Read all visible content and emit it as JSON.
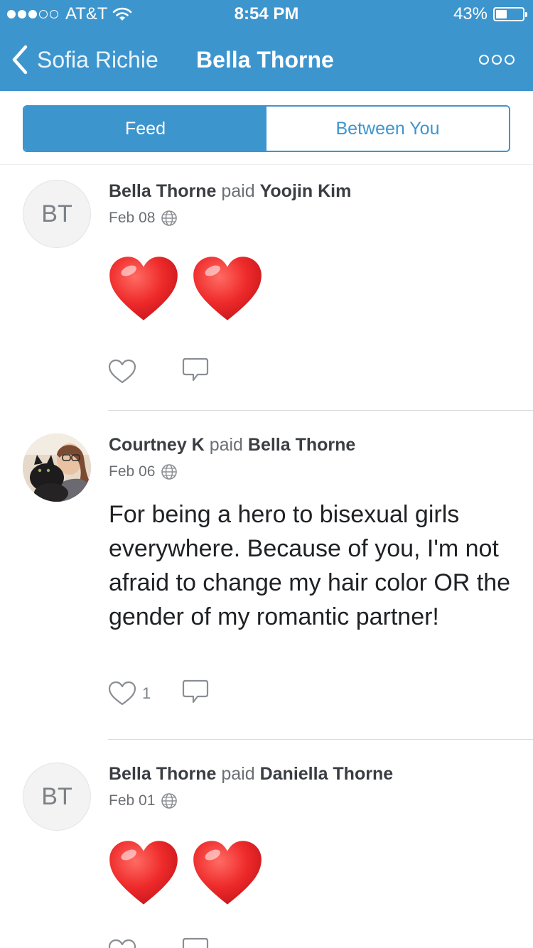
{
  "status_bar": {
    "carrier": "AT&T",
    "signal_filled": 3,
    "signal_total": 5,
    "time": "8:54 PM",
    "battery": "43%",
    "battery_level": 0.43
  },
  "nav": {
    "back_label": "Sofia Richie",
    "title": "Bella Thorne"
  },
  "tabs": [
    {
      "label": "Feed",
      "active": true
    },
    {
      "label": "Between You",
      "active": false
    }
  ],
  "feed": [
    {
      "avatar_initials": "BT",
      "actor": "Bella Thorne",
      "verb": "paid",
      "target": "Yoojin Kim",
      "date": "Feb 08",
      "message_emoji": "❤❤",
      "likes": ""
    },
    {
      "avatar_initials": "",
      "actor": "Courtney K",
      "verb": "paid",
      "target": "Bella Thorne",
      "date": "Feb 06",
      "message": "For being a hero to bisexual girls everywhere. Because of you, I'm not afraid to change my hair color OR the gender of my romantic partner!",
      "likes": "1"
    },
    {
      "avatar_initials": "BT",
      "actor": "Bella Thorne",
      "verb": "paid",
      "target": "Daniella Thorne",
      "date": "Feb 01",
      "message_emoji": "❤❤",
      "likes": ""
    }
  ],
  "colors": {
    "brand": "#3d95ce",
    "heart_red": "#e8262b"
  }
}
